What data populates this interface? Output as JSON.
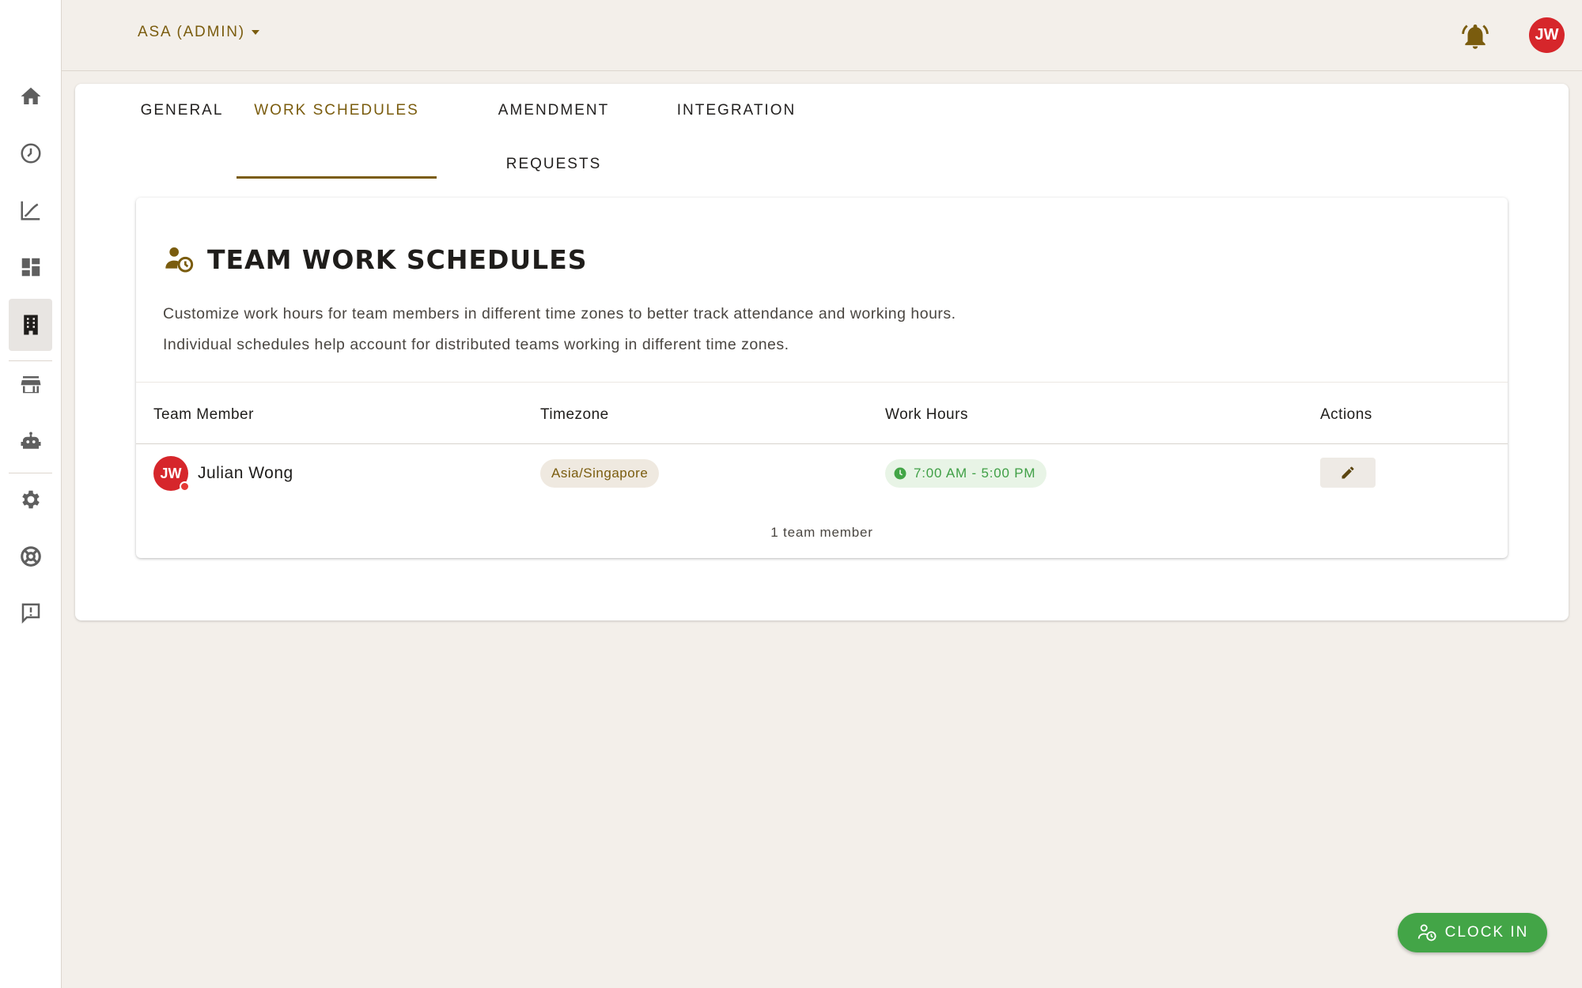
{
  "header": {
    "org_label": "ASA (ADMIN)",
    "avatar_initials": "JW"
  },
  "sidebar": {
    "items": [
      {
        "name": "home-icon"
      },
      {
        "name": "clock-icon"
      },
      {
        "name": "chart-line-icon"
      },
      {
        "name": "dashboard-icon"
      },
      {
        "name": "building-icon",
        "active": true
      },
      {
        "name": "store-icon"
      },
      {
        "name": "robot-icon"
      },
      {
        "name": "gear-icon"
      },
      {
        "name": "lifebuoy-icon"
      },
      {
        "name": "feedback-icon"
      }
    ]
  },
  "tabs": [
    {
      "label": "GENERAL"
    },
    {
      "label": "WORK SCHEDULES",
      "active": true
    },
    {
      "label": "AMENDMENT REQUESTS"
    },
    {
      "label": "INTEGRATION"
    }
  ],
  "card": {
    "title": "TEAM WORK SCHEDULES",
    "description_1": "Customize work hours for team members in different time zones to better track attendance and working hours.",
    "description_2": "Individual schedules help account for distributed teams working in different time zones.",
    "columns": [
      "Team Member",
      "Timezone",
      "Work Hours",
      "Actions"
    ],
    "rows": [
      {
        "initials": "JW",
        "name": "Julian Wong",
        "timezone": "Asia/Singapore",
        "work_hours": "7:00 AM - 5:00 PM"
      }
    ],
    "count_text": "1 team member"
  },
  "clock_in": {
    "label": "CLOCK IN"
  },
  "colors": {
    "accent": "#7a5c0e",
    "avatar": "#d6262b",
    "success": "#43a547",
    "background": "#f3efea"
  }
}
